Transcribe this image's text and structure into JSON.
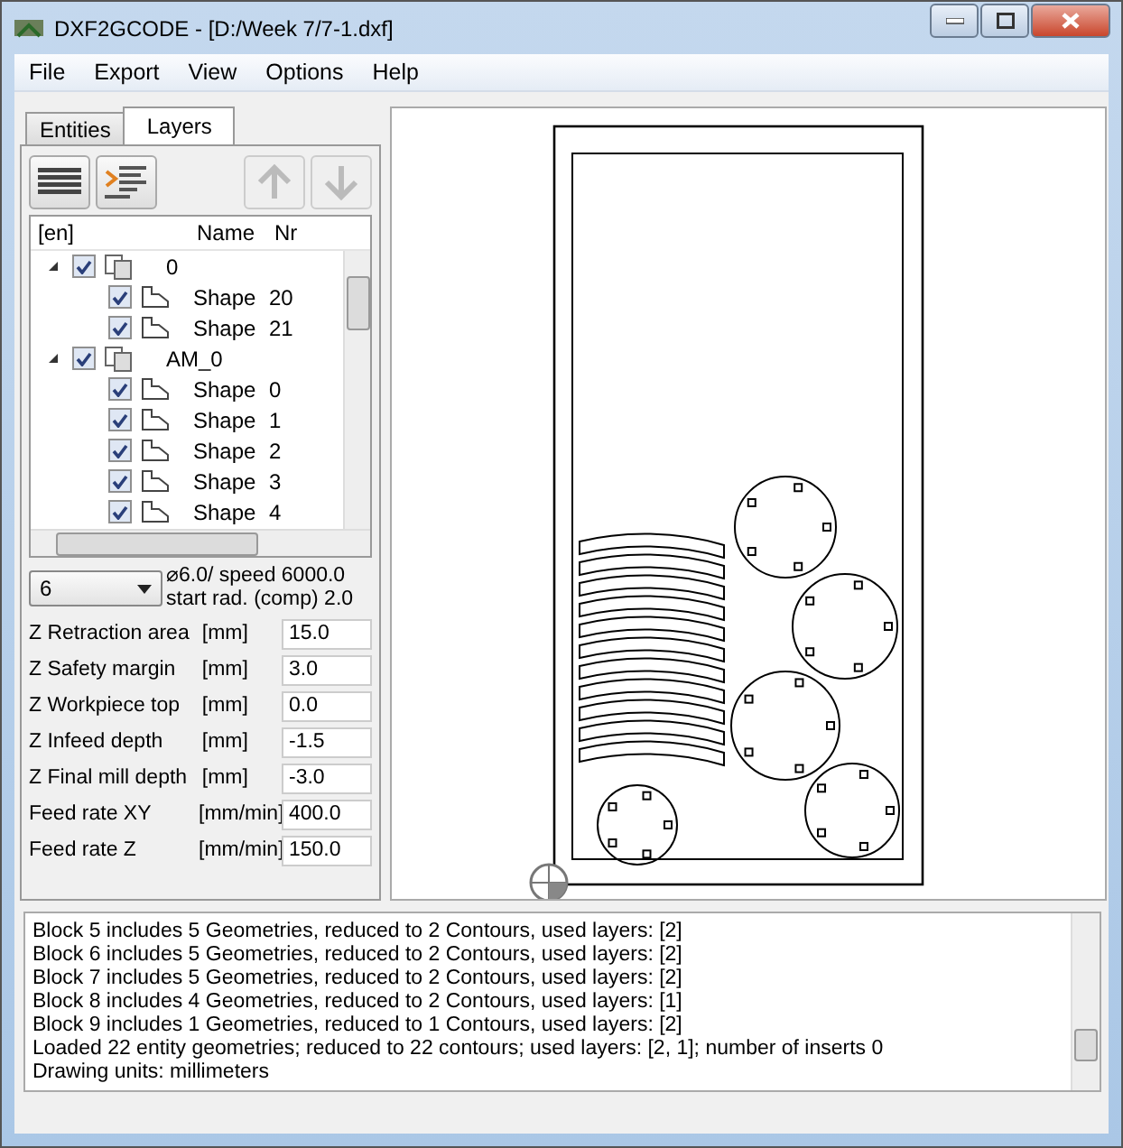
{
  "window": {
    "title": "DXF2GCODE - [D:/Week 7/7-1.dxf]"
  },
  "menu": [
    "File",
    "Export",
    "View",
    "Options",
    "Help"
  ],
  "tabs": [
    {
      "label": "Entities",
      "selected": false
    },
    {
      "label": "Layers",
      "selected": true
    }
  ],
  "toolbar_buttons": [
    {
      "kind": "list",
      "disabled": false
    },
    {
      "kind": "indent",
      "disabled": false
    },
    {
      "kind": "up",
      "disabled": true
    },
    {
      "kind": "down",
      "disabled": true
    }
  ],
  "layer_tree": {
    "columns": [
      "[en]",
      "Name",
      "Nr"
    ],
    "nodes": [
      {
        "name": "0",
        "checked": true,
        "expanded": true,
        "children": [
          {
            "name": "Shape",
            "nr": "20",
            "checked": true
          },
          {
            "name": "Shape",
            "nr": "21",
            "checked": true
          }
        ]
      },
      {
        "name": "AM_0",
        "checked": true,
        "expanded": true,
        "children": [
          {
            "name": "Shape",
            "nr": "0",
            "checked": true
          },
          {
            "name": "Shape",
            "nr": "1",
            "checked": true
          },
          {
            "name": "Shape",
            "nr": "2",
            "checked": true
          },
          {
            "name": "Shape",
            "nr": "3",
            "checked": true
          },
          {
            "name": "Shape",
            "nr": "4",
            "checked": true
          }
        ]
      }
    ]
  },
  "tool": {
    "value": "6",
    "info": [
      "⌀6.0/ speed 6000.0",
      "start rad. (comp) 2.0"
    ]
  },
  "parameters": [
    {
      "label": "Z Retraction area",
      "unit": "[mm]",
      "value": "15.0"
    },
    {
      "label": "Z Safety margin",
      "unit": "[mm]",
      "value": "3.0"
    },
    {
      "label": "Z Workpiece top",
      "unit": "[mm]",
      "value": "0.0"
    },
    {
      "label": "Z Infeed depth",
      "unit": "[mm]",
      "value": "-1.5"
    },
    {
      "label": "Z Final mill depth",
      "unit": "[mm]",
      "value": "-3.0"
    },
    {
      "label": "Feed rate XY",
      "unit": "[mm/min]",
      "value": "400.0"
    },
    {
      "label": "Feed rate Z",
      "unit": "[mm/min]",
      "value": "150.0"
    }
  ],
  "log": [
    "Block 5 includes 5 Geometries, reduced to 2 Contours, used layers: [2]",
    "Block 6 includes 5 Geometries, reduced to 2 Contours, used layers: [2]",
    "Block 7 includes 5 Geometries, reduced to 2 Contours, used layers: [2]",
    "Block 8 includes 4 Geometries, reduced to 2 Contours, used layers: [1]",
    "Block 9 includes 1 Geometries, reduced to 1 Contours, used layers: [2]",
    "Loaded 22 entity geometries; reduced to 22 contours; used layers: [2, 1]; number of inserts 0",
    "Drawing units: millimeters"
  ]
}
